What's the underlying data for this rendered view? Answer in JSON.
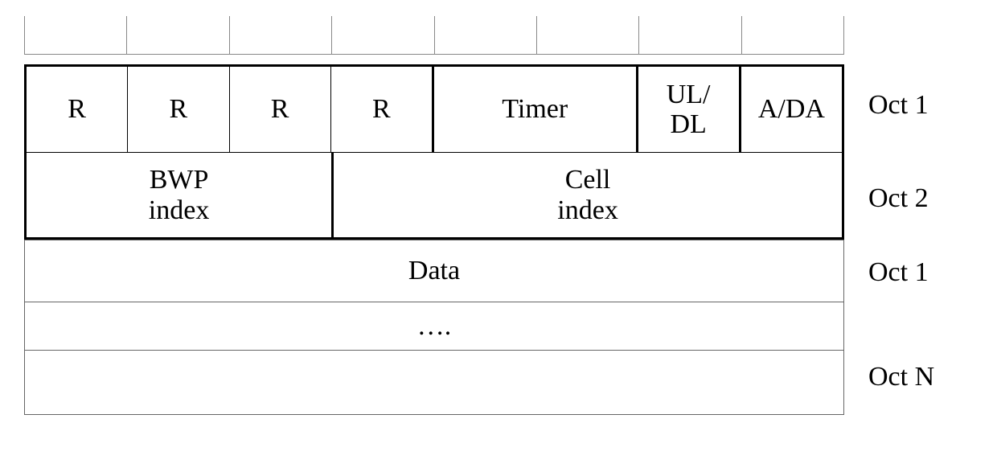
{
  "oct1": {
    "r1": "R",
    "r2": "R",
    "r3": "R",
    "r4": "R",
    "timer": "Timer",
    "uldl": "UL/\nDL",
    "ada": "A/DA"
  },
  "oct2": {
    "bwp": "BWP\nindex",
    "cell": "Cell\nindex"
  },
  "data_row": "Data",
  "ellipsis": "….",
  "labels": {
    "oct1": "Oct 1",
    "oct2": "Oct 2",
    "oct1_again": "Oct 1",
    "octN": "Oct N"
  }
}
